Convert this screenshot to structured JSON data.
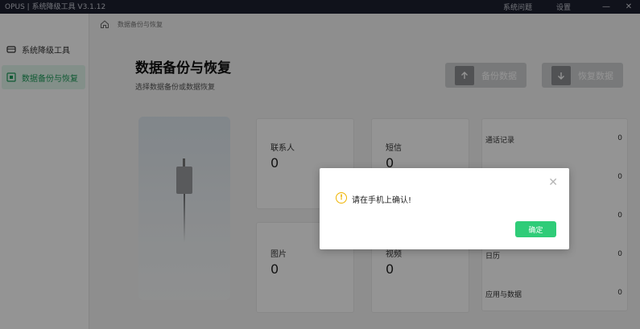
{
  "titlebar": {
    "app_title": "OPUS | 系统降级工具  V3.1.12",
    "links": [
      "系统问题",
      "设置"
    ],
    "minimize": "—",
    "close": "✕"
  },
  "sidebar": {
    "items": [
      {
        "label": "系统降级工具",
        "icon": "device-icon"
      },
      {
        "label": "数据备份与恢复",
        "icon": "backup-icon",
        "active": true
      }
    ]
  },
  "breadcrumb": {
    "text": "数据备份与恢复"
  },
  "main": {
    "title": "数据备份与恢复",
    "subtitle": "选择数据备份或数据恢复",
    "backup_label": "备份数据",
    "restore_label": "恢复数据"
  },
  "stats": {
    "contacts": {
      "label": "联系人",
      "value": "0"
    },
    "sms": {
      "label": "短信",
      "value": "0"
    },
    "photos": {
      "label": "图片",
      "value": "0"
    },
    "videos": {
      "label": "视频",
      "value": "0"
    }
  },
  "list": [
    {
      "label": "通话记录",
      "value": "0"
    },
    {
      "label": "",
      "value": "0"
    },
    {
      "label": "",
      "value": "0"
    },
    {
      "label": "日历",
      "value": "0"
    },
    {
      "label": "应用与数据",
      "value": "0"
    }
  ],
  "dialog": {
    "message": "请在手机上确认!",
    "confirm_label": "确定",
    "icon": "warning-icon"
  },
  "colors": {
    "accent": "#2fcc78",
    "titlebar": "#1c2030",
    "warning": "#f0b400"
  }
}
